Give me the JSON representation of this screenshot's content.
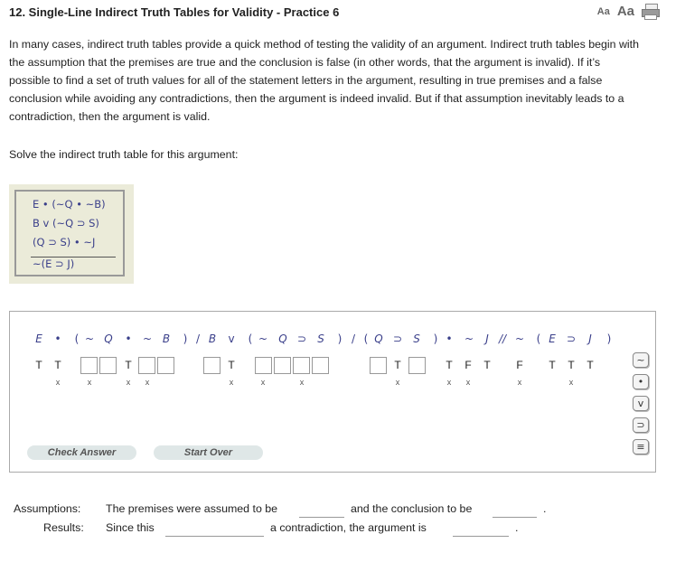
{
  "header": {
    "title": "12.  Single-Line Indirect Truth Tables for Validity - Practice 6",
    "font_small": "Aa",
    "font_large": "Aa"
  },
  "intro": {
    "paragraph": "In many cases, indirect truth tables provide a quick method of testing the validity of an argument. Indirect truth tables begin with the assumption that the premises are true and the conclusion is false (in other words, that the argument is invalid). If it’s possible to find a set of truth values for all of the statement letters in the argument, resulting in true premises and a false conclusion while avoiding any contradictions, then the argument is indeed invalid. But if that assumption inevitably leads to a contradiction, then the argument is valid.",
    "solve": "Solve the indirect truth table for this argument:"
  },
  "argument": {
    "premises": [
      "E • (~Q • ~B)",
      "B v (~Q ⊃ S)",
      "(Q ⊃ S) • ~J"
    ],
    "conclusion": "~(E ⊃ J)"
  },
  "table": {
    "symbols": [
      "E",
      "•",
      "(",
      "~",
      "Q",
      "•",
      "~",
      "B",
      ")",
      "/",
      "B",
      "v",
      "(",
      "~",
      "Q",
      "⊃",
      "S",
      ")",
      "/",
      "(",
      "Q",
      "⊃",
      "S",
      ")",
      "•",
      "~",
      "J",
      "//",
      "~",
      "(",
      "E",
      "⊃",
      "J",
      ")"
    ],
    "values": [
      "T",
      "T",
      "T",
      "T",
      "T",
      "T",
      "F",
      "T",
      "F",
      "T",
      "T",
      "T"
    ],
    "marks": [
      "x",
      "x",
      "x",
      "x",
      "x",
      "x",
      "x",
      "x",
      "x",
      "x",
      "x",
      "x"
    ],
    "check_label": "Check Answer",
    "start_label": "Start Over",
    "palette": [
      "~",
      "•",
      "v",
      "⊃",
      "≡"
    ]
  },
  "assumptions": {
    "label": "Assumptions:",
    "text1": "The premises were assumed to be",
    "text2": "and the conclusion to be",
    "end": "."
  },
  "results": {
    "label": "Results:",
    "text1": "Since this",
    "text2": "a contradiction, the argument is",
    "end": "."
  }
}
